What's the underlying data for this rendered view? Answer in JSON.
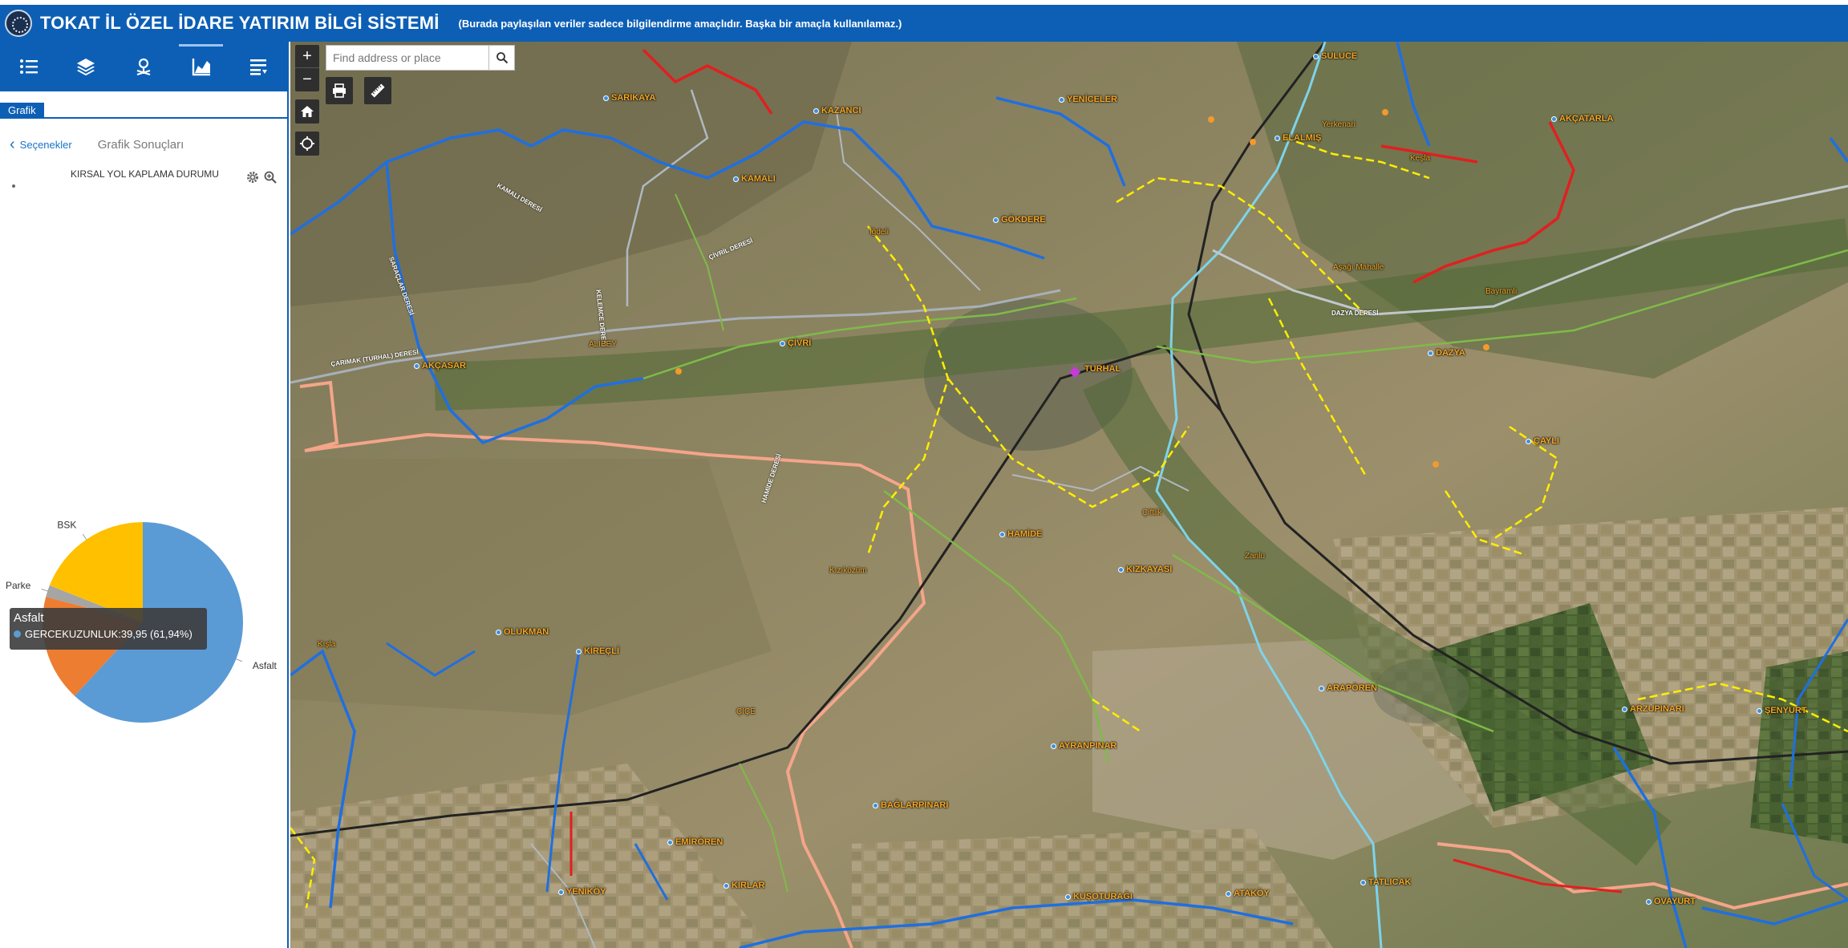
{
  "header": {
    "title": "TOKAT İL ÖZEL İDARE YATIRIM BİLGİ SİSTEMİ",
    "disclaimer": "(Burada paylaşılan veriler sadece bilgilendirme amaçlıdır. Başka bir amaçla kullanılamaz.)"
  },
  "toolbar": {
    "icons": [
      "list-icon",
      "layers-icon",
      "location-pin-icon",
      "chart-icon",
      "query-list-icon"
    ],
    "active": "chart-icon"
  },
  "panel": {
    "tab": "Grafik",
    "back_label": "Seçenekler",
    "title": "Grafik Sonuçları",
    "chart_title": "KIRSAL YOL KAPLAMA DURUMU"
  },
  "chart_data": {
    "type": "pie",
    "title": "KIRSAL YOL KAPLAMA DURUMU",
    "slices": [
      {
        "label": "Asfalt",
        "value": 61.94,
        "color": "#5b9bd5"
      },
      {
        "label": "",
        "value": 17.2,
        "color": "#ed7d31"
      },
      {
        "label": "Parke",
        "value": 1.9,
        "color": "#a5a5a5"
      },
      {
        "label": "BSK",
        "value": 19.0,
        "color": "#ffc000"
      }
    ],
    "tooltip": {
      "title": "Asfalt",
      "text": "GERCEKUZUNLUK:39,95  (61,94%)"
    }
  },
  "map": {
    "search_placeholder": "Find address or place",
    "zoom_in": "+",
    "zoom_out": "−",
    "places": [
      {
        "name": "SULUCE",
        "dot": true
      },
      {
        "name": "YENİCELER",
        "dot": true
      },
      {
        "name": "SARIKAYA",
        "dot": true
      },
      {
        "name": "KAZANCI",
        "dot": true
      },
      {
        "name": "KAMALI",
        "dot": true
      },
      {
        "name": "Yerkenari",
        "dot": false
      },
      {
        "name": "ELALMIŞ",
        "dot": true
      },
      {
        "name": "Keşla",
        "dot": false
      },
      {
        "name": "AKÇATARLA",
        "dot": true
      },
      {
        "name": "GÖKDERE",
        "dot": true
      },
      {
        "name": "İğdeli",
        "dot": false
      },
      {
        "name": "Aşağı Mahalle",
        "dot": false
      },
      {
        "name": "Bayramlı",
        "dot": false
      },
      {
        "name": "ÇİVRİ",
        "dot": true
      },
      {
        "name": "ALİBEY",
        "dot": false
      },
      {
        "name": "AKÇASAR",
        "dot": true
      },
      {
        "name": "DAZYA",
        "dot": true
      },
      {
        "name": "TURHAL",
        "dot": false
      },
      {
        "name": "ÇAYLI",
        "dot": true
      },
      {
        "name": "HAMİDE",
        "dot": true
      },
      {
        "name": "Çiftlik",
        "dot": false
      },
      {
        "name": "KIZKAYASI",
        "dot": true
      },
      {
        "name": "Zanlu",
        "dot": false
      },
      {
        "name": "Kızıközüm",
        "dot": false
      },
      {
        "name": "OLUKMAN",
        "dot": true
      },
      {
        "name": "KİREÇLİ",
        "dot": true
      },
      {
        "name": "Kışla",
        "dot": false
      },
      {
        "name": "ARAPÖREN",
        "dot": true
      },
      {
        "name": "ARZUPINARI",
        "dot": true
      },
      {
        "name": "ŞENYURT",
        "dot": true
      },
      {
        "name": "ÇİÇE",
        "dot": false
      },
      {
        "name": "AYRANPINAR",
        "dot": true
      },
      {
        "name": "BAĞLARPINARI",
        "dot": true
      },
      {
        "name": "EMİRÖREN",
        "dot": true
      },
      {
        "name": "KIRLAR",
        "dot": true
      },
      {
        "name": "YENİKÖY",
        "dot": true
      },
      {
        "name": "KUŞOTURAĞI",
        "dot": true
      },
      {
        "name": "ATAKÖY",
        "dot": true
      },
      {
        "name": "TATLICAK",
        "dot": true
      },
      {
        "name": "OVAYURT",
        "dot": true
      }
    ],
    "rivers": [
      "ÇİVRİL DERESİ",
      "DAZYA DERESİ",
      "ÇARIMAK (TURHAL) DERESİ",
      "SARAÇLAR DERESİ",
      "KELEMCE DERESİ",
      "HAMİDE DERESİ",
      "KAMALI DERESİ"
    ]
  }
}
